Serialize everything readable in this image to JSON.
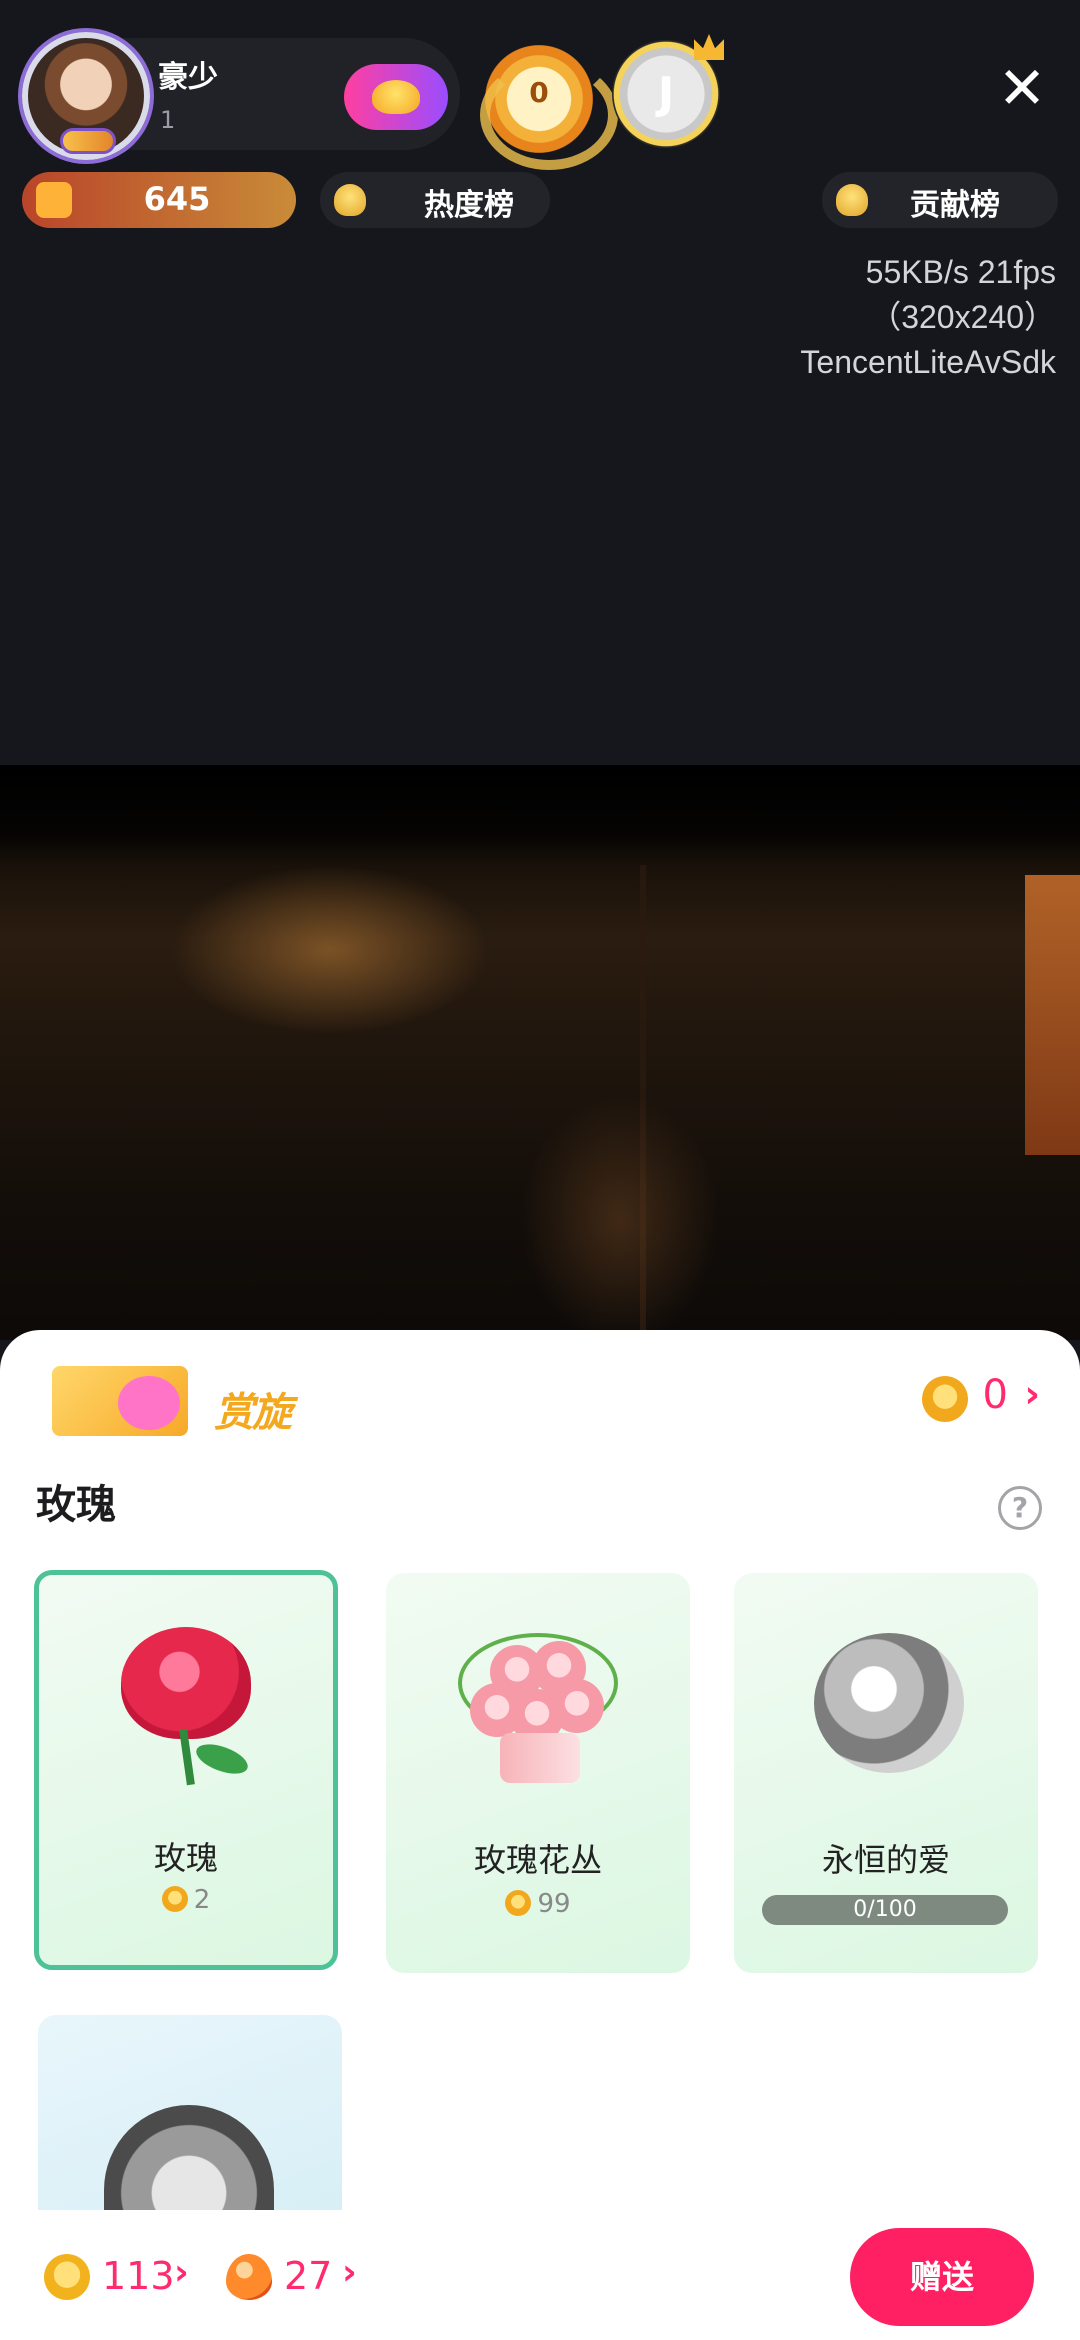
{
  "header": {
    "host_name": "豪少",
    "host_sub": "1",
    "medal_value": "0",
    "guard_glyph": "J",
    "close_glyph": "✕"
  },
  "pills": {
    "coins": "645",
    "hot_rank": "热度榜",
    "contrib_rank": "贡献榜"
  },
  "stats": {
    "line1": "55KB/s 21fps",
    "line2": "（320x240）",
    "line3": "TencentLiteAvSdk"
  },
  "panel": {
    "banner_title": "赏旋",
    "balance_value": "0",
    "balance_arrow": "›",
    "section_title": "玫瑰",
    "help_glyph": "?",
    "gifts": [
      {
        "name": "玫瑰",
        "price": "2",
        "selected": true
      },
      {
        "name": "玫瑰花丛",
        "price": "99"
      },
      {
        "name": "永恒的爱",
        "progress_text": "0/100",
        "progress": 0
      }
    ]
  },
  "bottom": {
    "coins_value": "113",
    "beans_value": "27",
    "arrow": "›",
    "send_label": "赠送"
  },
  "colors": {
    "accent": "#ff1f63",
    "selected_border": "#4cc296"
  }
}
